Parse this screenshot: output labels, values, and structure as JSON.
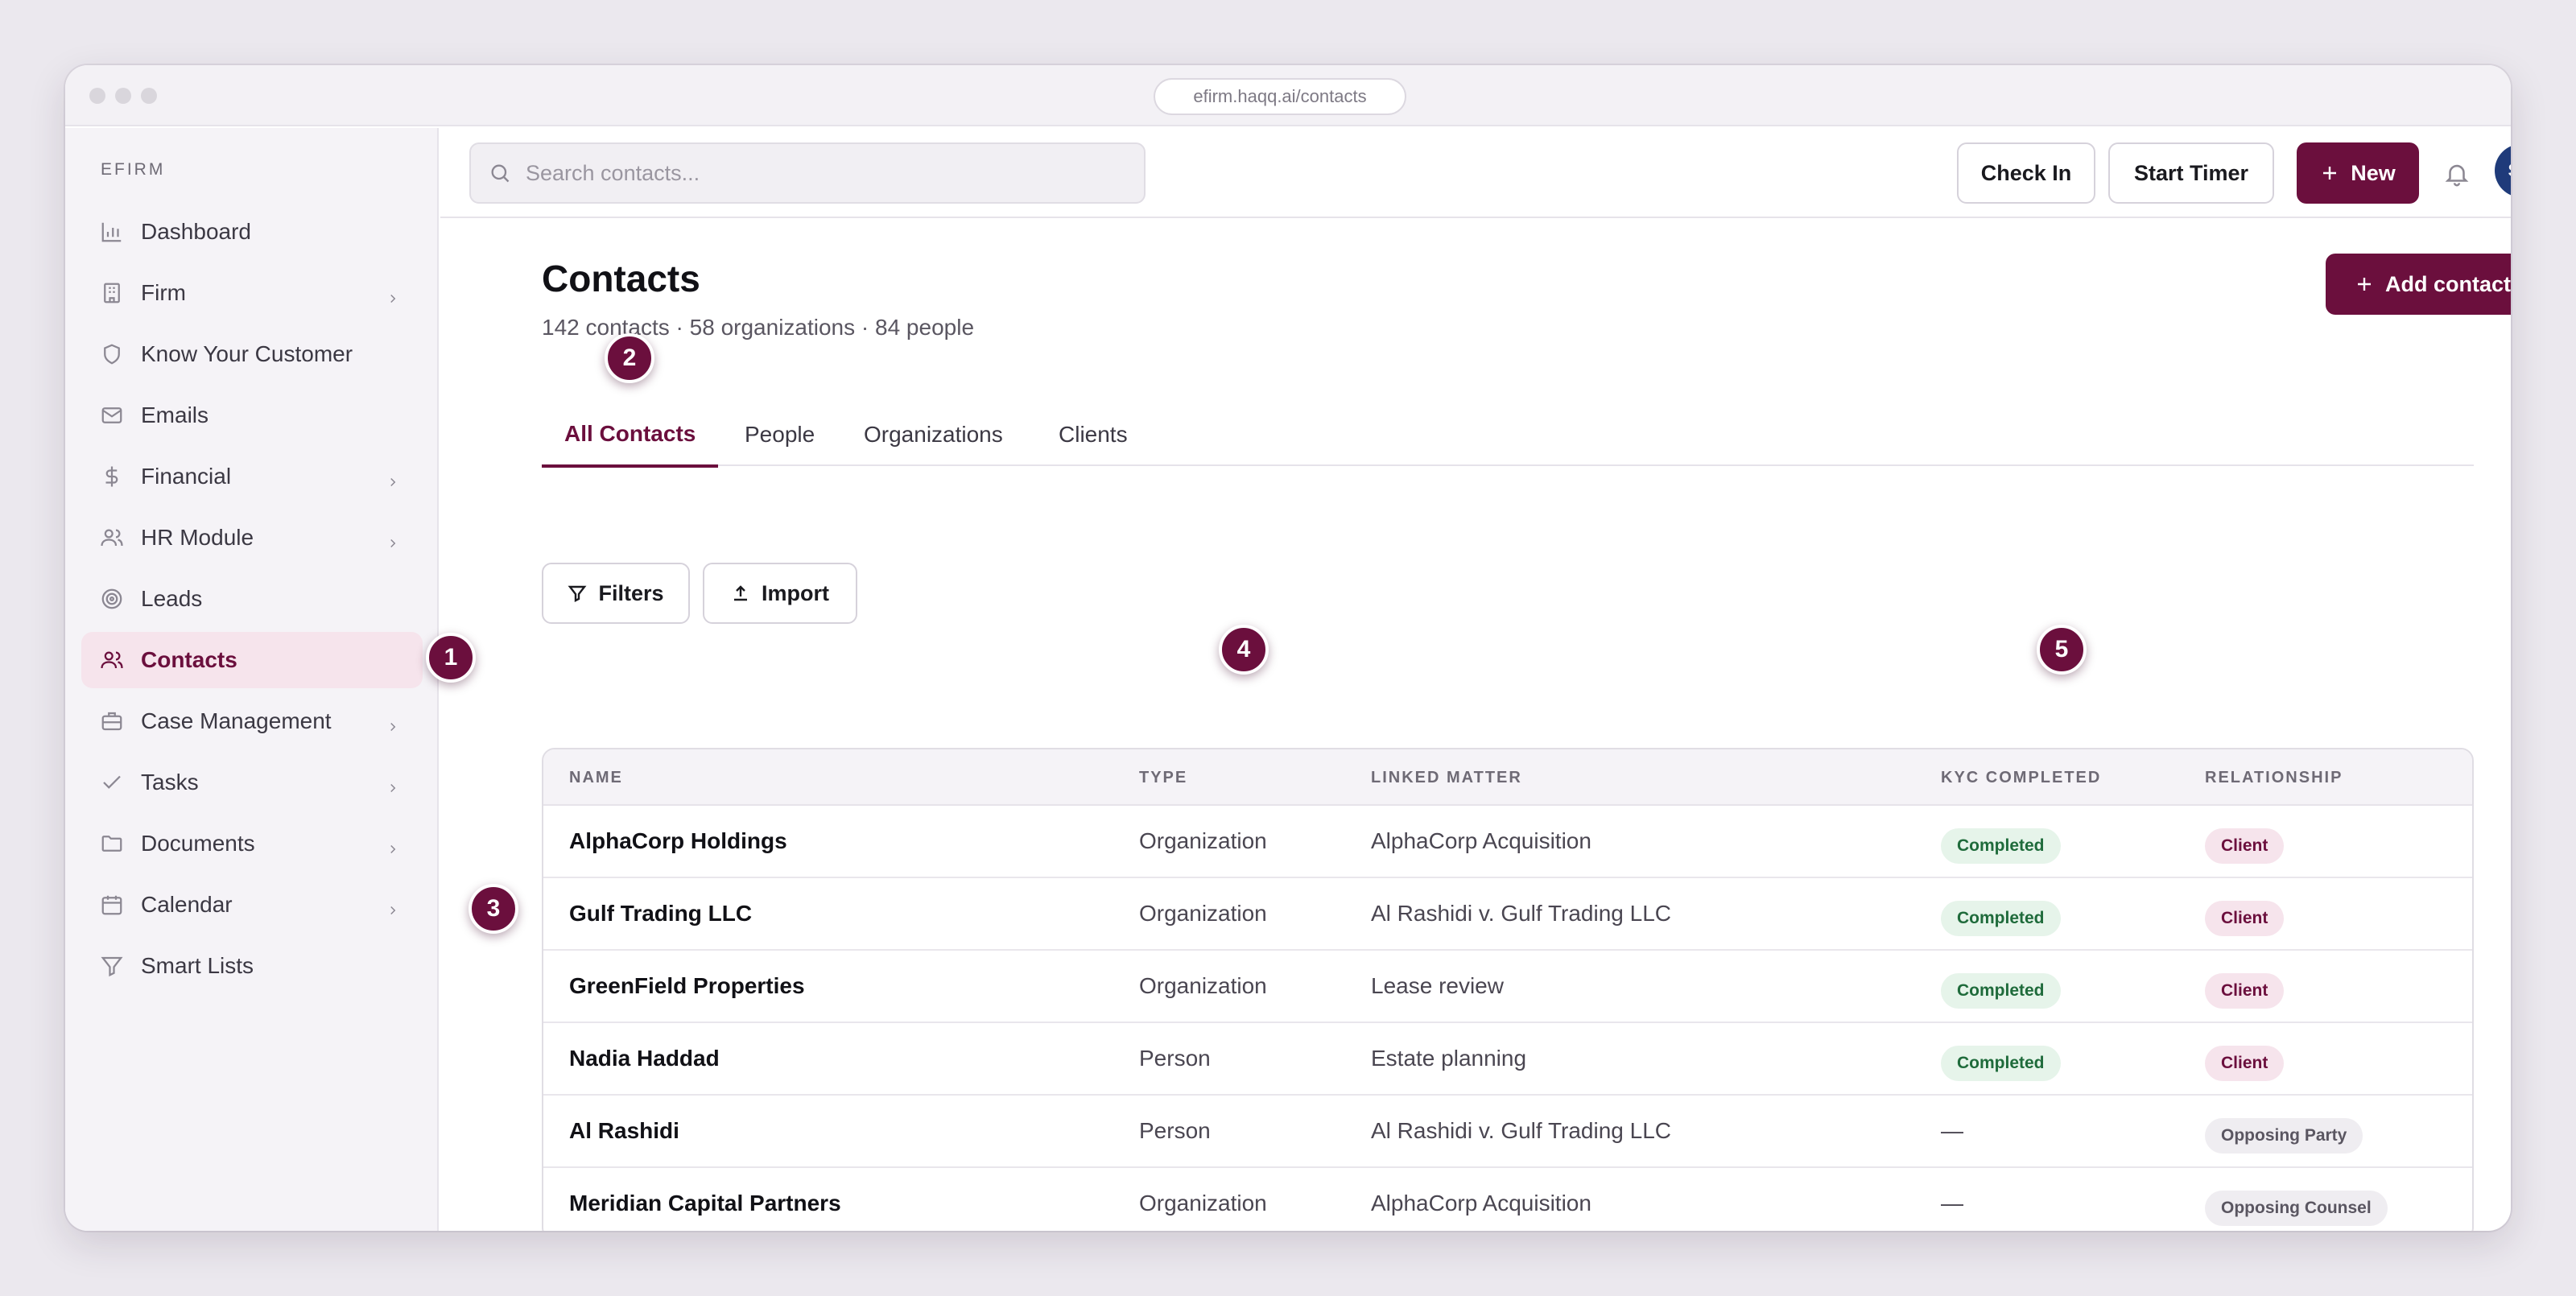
{
  "browser": {
    "url": "efirm.haqq.ai/contacts"
  },
  "sidebar": {
    "brand": "EFIRM",
    "items": [
      {
        "label": "Dashboard",
        "icon": "chart-bar-icon",
        "chevron": false
      },
      {
        "label": "Firm",
        "icon": "building-icon",
        "chevron": true
      },
      {
        "label": "Know Your Customer",
        "icon": "shield-icon",
        "chevron": false
      },
      {
        "label": "Emails",
        "icon": "mail-icon",
        "chevron": false
      },
      {
        "label": "Financial",
        "icon": "dollar-icon",
        "chevron": true
      },
      {
        "label": "HR Module",
        "icon": "users-icon",
        "chevron": true
      },
      {
        "label": "Leads",
        "icon": "target-icon",
        "chevron": false
      },
      {
        "label": "Contacts",
        "icon": "users-icon",
        "chevron": false,
        "active": true
      },
      {
        "label": "Case Management",
        "icon": "briefcase-icon",
        "chevron": true
      },
      {
        "label": "Tasks",
        "icon": "check-icon",
        "chevron": true
      },
      {
        "label": "Documents",
        "icon": "folder-icon",
        "chevron": true
      },
      {
        "label": "Calendar",
        "icon": "calendar-icon",
        "chevron": true
      },
      {
        "label": "Smart Lists",
        "icon": "filter-icon",
        "chevron": false
      }
    ]
  },
  "header": {
    "search_placeholder": "Search contacts...",
    "check_in_label": "Check In",
    "start_timer_label": "Start Timer",
    "new_label": "New",
    "avatar_initials": "SM"
  },
  "page": {
    "title": "Contacts",
    "subtitle": "142 contacts · 58 organizations · 84 people",
    "add_contact_label": "Add contact",
    "tabs": [
      "All Contacts",
      "People",
      "Organizations",
      "Clients"
    ],
    "active_tab": "All Contacts",
    "filters_label": "Filters",
    "import_label": "Import"
  },
  "table": {
    "columns": [
      "NAME",
      "TYPE",
      "LINKED MATTER",
      "KYC COMPLETED",
      "RELATIONSHIP"
    ],
    "rows": [
      {
        "name": "AlphaCorp Holdings",
        "type": "Organization",
        "matter": "AlphaCorp Acquisition",
        "kyc": "Completed",
        "relationship": "Client"
      },
      {
        "name": "Gulf Trading LLC",
        "type": "Organization",
        "matter": "Al Rashidi v. Gulf Trading LLC",
        "kyc": "Completed",
        "relationship": "Client"
      },
      {
        "name": "GreenField Properties",
        "type": "Organization",
        "matter": "Lease review",
        "kyc": "Completed",
        "relationship": "Client"
      },
      {
        "name": "Nadia Haddad",
        "type": "Person",
        "matter": "Estate planning",
        "kyc": "Completed",
        "relationship": "Client"
      },
      {
        "name": "Al Rashidi",
        "type": "Person",
        "matter": "Al Rashidi v. Gulf Trading LLC",
        "kyc": "—",
        "relationship": "Opposing Party"
      },
      {
        "name": "Meridian Capital Partners",
        "type": "Organization",
        "matter": "AlphaCorp Acquisition",
        "kyc": "—",
        "relationship": "Opposing Counsel"
      }
    ]
  },
  "markers": [
    "1",
    "2",
    "3",
    "4",
    "5"
  ],
  "colors": {
    "accent": "#6b0f3d",
    "avatar": "#1f3b7a",
    "kyc_green": "#1f6b3b"
  }
}
